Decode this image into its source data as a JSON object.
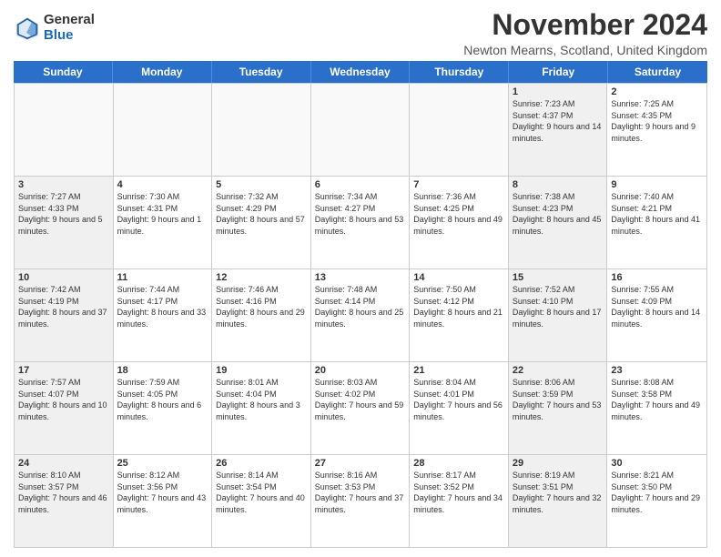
{
  "logo": {
    "general": "General",
    "blue": "Blue"
  },
  "title": "November 2024",
  "location": "Newton Mearns, Scotland, United Kingdom",
  "header_days": [
    "Sunday",
    "Monday",
    "Tuesday",
    "Wednesday",
    "Thursday",
    "Friday",
    "Saturday"
  ],
  "rows": [
    [
      {
        "day": "",
        "info": "",
        "empty": true
      },
      {
        "day": "",
        "info": "",
        "empty": true
      },
      {
        "day": "",
        "info": "",
        "empty": true
      },
      {
        "day": "",
        "info": "",
        "empty": true
      },
      {
        "day": "",
        "info": "",
        "empty": true
      },
      {
        "day": "1",
        "info": "Sunrise: 7:23 AM\nSunset: 4:37 PM\nDaylight: 9 hours and 14 minutes.",
        "shaded": true
      },
      {
        "day": "2",
        "info": "Sunrise: 7:25 AM\nSunset: 4:35 PM\nDaylight: 9 hours and 9 minutes.",
        "shaded": false
      }
    ],
    [
      {
        "day": "3",
        "info": "Sunrise: 7:27 AM\nSunset: 4:33 PM\nDaylight: 9 hours and 5 minutes.",
        "shaded": true
      },
      {
        "day": "4",
        "info": "Sunrise: 7:30 AM\nSunset: 4:31 PM\nDaylight: 9 hours and 1 minute.",
        "shaded": false
      },
      {
        "day": "5",
        "info": "Sunrise: 7:32 AM\nSunset: 4:29 PM\nDaylight: 8 hours and 57 minutes.",
        "shaded": false
      },
      {
        "day": "6",
        "info": "Sunrise: 7:34 AM\nSunset: 4:27 PM\nDaylight: 8 hours and 53 minutes.",
        "shaded": false
      },
      {
        "day": "7",
        "info": "Sunrise: 7:36 AM\nSunset: 4:25 PM\nDaylight: 8 hours and 49 minutes.",
        "shaded": false
      },
      {
        "day": "8",
        "info": "Sunrise: 7:38 AM\nSunset: 4:23 PM\nDaylight: 8 hours and 45 minutes.",
        "shaded": true
      },
      {
        "day": "9",
        "info": "Sunrise: 7:40 AM\nSunset: 4:21 PM\nDaylight: 8 hours and 41 minutes.",
        "shaded": false
      }
    ],
    [
      {
        "day": "10",
        "info": "Sunrise: 7:42 AM\nSunset: 4:19 PM\nDaylight: 8 hours and 37 minutes.",
        "shaded": true
      },
      {
        "day": "11",
        "info": "Sunrise: 7:44 AM\nSunset: 4:17 PM\nDaylight: 8 hours and 33 minutes.",
        "shaded": false
      },
      {
        "day": "12",
        "info": "Sunrise: 7:46 AM\nSunset: 4:16 PM\nDaylight: 8 hours and 29 minutes.",
        "shaded": false
      },
      {
        "day": "13",
        "info": "Sunrise: 7:48 AM\nSunset: 4:14 PM\nDaylight: 8 hours and 25 minutes.",
        "shaded": false
      },
      {
        "day": "14",
        "info": "Sunrise: 7:50 AM\nSunset: 4:12 PM\nDaylight: 8 hours and 21 minutes.",
        "shaded": false
      },
      {
        "day": "15",
        "info": "Sunrise: 7:52 AM\nSunset: 4:10 PM\nDaylight: 8 hours and 17 minutes.",
        "shaded": true
      },
      {
        "day": "16",
        "info": "Sunrise: 7:55 AM\nSunset: 4:09 PM\nDaylight: 8 hours and 14 minutes.",
        "shaded": false
      }
    ],
    [
      {
        "day": "17",
        "info": "Sunrise: 7:57 AM\nSunset: 4:07 PM\nDaylight: 8 hours and 10 minutes.",
        "shaded": true
      },
      {
        "day": "18",
        "info": "Sunrise: 7:59 AM\nSunset: 4:05 PM\nDaylight: 8 hours and 6 minutes.",
        "shaded": false
      },
      {
        "day": "19",
        "info": "Sunrise: 8:01 AM\nSunset: 4:04 PM\nDaylight: 8 hours and 3 minutes.",
        "shaded": false
      },
      {
        "day": "20",
        "info": "Sunrise: 8:03 AM\nSunset: 4:02 PM\nDaylight: 7 hours and 59 minutes.",
        "shaded": false
      },
      {
        "day": "21",
        "info": "Sunrise: 8:04 AM\nSunset: 4:01 PM\nDaylight: 7 hours and 56 minutes.",
        "shaded": false
      },
      {
        "day": "22",
        "info": "Sunrise: 8:06 AM\nSunset: 3:59 PM\nDaylight: 7 hours and 53 minutes.",
        "shaded": true
      },
      {
        "day": "23",
        "info": "Sunrise: 8:08 AM\nSunset: 3:58 PM\nDaylight: 7 hours and 49 minutes.",
        "shaded": false
      }
    ],
    [
      {
        "day": "24",
        "info": "Sunrise: 8:10 AM\nSunset: 3:57 PM\nDaylight: 7 hours and 46 minutes.",
        "shaded": true
      },
      {
        "day": "25",
        "info": "Sunrise: 8:12 AM\nSunset: 3:56 PM\nDaylight: 7 hours and 43 minutes.",
        "shaded": false
      },
      {
        "day": "26",
        "info": "Sunrise: 8:14 AM\nSunset: 3:54 PM\nDaylight: 7 hours and 40 minutes.",
        "shaded": false
      },
      {
        "day": "27",
        "info": "Sunrise: 8:16 AM\nSunset: 3:53 PM\nDaylight: 7 hours and 37 minutes.",
        "shaded": false
      },
      {
        "day": "28",
        "info": "Sunrise: 8:17 AM\nSunset: 3:52 PM\nDaylight: 7 hours and 34 minutes.",
        "shaded": false
      },
      {
        "day": "29",
        "info": "Sunrise: 8:19 AM\nSunset: 3:51 PM\nDaylight: 7 hours and 32 minutes.",
        "shaded": true
      },
      {
        "day": "30",
        "info": "Sunrise: 8:21 AM\nSunset: 3:50 PM\nDaylight: 7 hours and 29 minutes.",
        "shaded": false
      }
    ]
  ]
}
